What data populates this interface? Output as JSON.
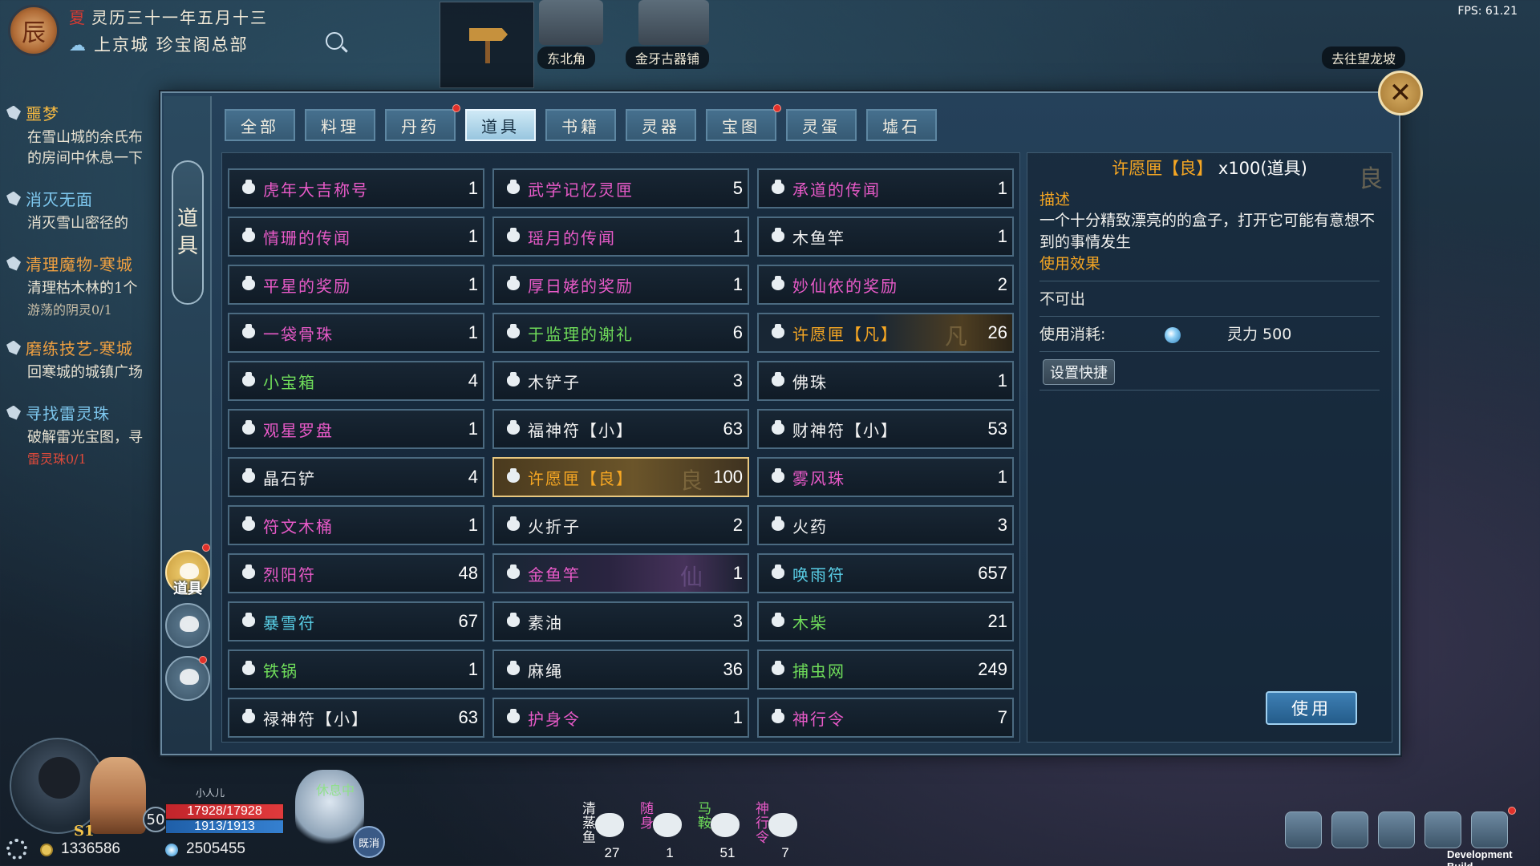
{
  "header": {
    "badge": "辰",
    "season": "夏",
    "date": "灵历三十一年五月十三",
    "location": "上京城  珍宝阁总部",
    "fps": "FPS: 61.21"
  },
  "map_labels": {
    "northeast": "东北角",
    "shop": "金牙古器铺",
    "goto": "去往望龙坡"
  },
  "quests": [
    {
      "title": "噩梦",
      "title_color": "#f5b942",
      "desc": "在雪山城的余氏布",
      "desc2": "的房间中休息一下",
      "progress": ""
    },
    {
      "title": "消灭无面",
      "title_color": "#7ec8ef",
      "desc": "消灭雪山密径的",
      "desc2": "",
      "progress": ""
    },
    {
      "title": "清理魔物-寒城",
      "title_color": "#f0a040",
      "desc": "清理枯木林的1个",
      "desc2": "",
      "progress": "游荡的阴灵0/1"
    },
    {
      "title": "磨练技艺-寒城",
      "title_color": "#f0a040",
      "desc": "回寒城的城镇广场",
      "desc2": "",
      "progress": ""
    },
    {
      "title": "寻找雷灵珠",
      "title_color": "#7ec8ef",
      "desc": "破解雷光宝图，寻",
      "desc2": "",
      "progress": "雷灵珠0/1"
    }
  ],
  "rail": {
    "tag": [
      "道",
      "具"
    ],
    "active_label": "道具"
  },
  "tabs": [
    {
      "label": "全部",
      "active": false,
      "dot": false
    },
    {
      "label": "料理",
      "active": false,
      "dot": false
    },
    {
      "label": "丹药",
      "active": false,
      "dot": true
    },
    {
      "label": "道具",
      "active": true,
      "dot": false
    },
    {
      "label": "书籍",
      "active": false,
      "dot": false
    },
    {
      "label": "灵器",
      "active": false,
      "dot": false
    },
    {
      "label": "宝图",
      "active": false,
      "dot": true
    },
    {
      "label": "灵蛋",
      "active": false,
      "dot": false
    },
    {
      "label": "墟石",
      "active": false,
      "dot": false
    }
  ],
  "colors": {
    "pink": "#e85ac8",
    "green": "#6fdc5a",
    "white": "#f2f2f2",
    "cyan": "#5ad0e8",
    "orange": "#f5a623"
  },
  "items": [
    {
      "name": "虎年大吉称号",
      "count": "1",
      "color": "pink"
    },
    {
      "name": "武学记忆灵匣",
      "count": "5",
      "color": "pink"
    },
    {
      "name": "承道的传闻",
      "count": "1",
      "color": "pink"
    },
    {
      "name": "情珊的传闻",
      "count": "1",
      "color": "pink"
    },
    {
      "name": "瑶月的传闻",
      "count": "1",
      "color": "pink"
    },
    {
      "name": "木鱼竿",
      "count": "1",
      "color": "white"
    },
    {
      "name": "平星的奖励",
      "count": "1",
      "color": "pink"
    },
    {
      "name": "厚日姥的奖励",
      "count": "1",
      "color": "pink"
    },
    {
      "name": "妙仙依的奖励",
      "count": "2",
      "color": "pink"
    },
    {
      "name": "一袋骨珠",
      "count": "1",
      "color": "pink"
    },
    {
      "name": "于监理的谢礼",
      "count": "6",
      "color": "green"
    },
    {
      "name": "许愿匣【凡】",
      "count": "26",
      "color": "orange",
      "style": "glow-gold",
      "mark": "凡"
    },
    {
      "name": "小宝箱",
      "count": "4",
      "color": "green"
    },
    {
      "name": "木铲子",
      "count": "3",
      "color": "white"
    },
    {
      "name": "佛珠",
      "count": "1",
      "color": "white"
    },
    {
      "name": "观星罗盘",
      "count": "1",
      "color": "pink"
    },
    {
      "name": "福神符【小】",
      "count": "63",
      "color": "white"
    },
    {
      "name": "财神符【小】",
      "count": "53",
      "color": "white"
    },
    {
      "name": "晶石铲",
      "count": "4",
      "color": "white"
    },
    {
      "name": "许愿匣【良】",
      "count": "100",
      "color": "orange",
      "style": "selected",
      "mark": "良"
    },
    {
      "name": "雾风珠",
      "count": "1",
      "color": "pink"
    },
    {
      "name": "符文木桶",
      "count": "1",
      "color": "pink"
    },
    {
      "name": "火折子",
      "count": "2",
      "color": "white"
    },
    {
      "name": "火药",
      "count": "3",
      "color": "white"
    },
    {
      "name": "烈阳符",
      "count": "48",
      "color": "pink"
    },
    {
      "name": "金鱼竿",
      "count": "1",
      "color": "pink",
      "style": "glow-purple",
      "mark": "仙"
    },
    {
      "name": "唤雨符",
      "count": "657",
      "color": "cyan"
    },
    {
      "name": "暴雪符",
      "count": "67",
      "color": "cyan"
    },
    {
      "name": "素油",
      "count": "3",
      "color": "white"
    },
    {
      "name": "木柴",
      "count": "21",
      "color": "green"
    },
    {
      "name": "铁锅",
      "count": "1",
      "color": "green"
    },
    {
      "name": "麻绳",
      "count": "36",
      "color": "white"
    },
    {
      "name": "捕虫网",
      "count": "249",
      "color": "green"
    },
    {
      "name": "禄神符【小】",
      "count": "63",
      "color": "white"
    },
    {
      "name": "护身令",
      "count": "1",
      "color": "pink"
    },
    {
      "name": "神行令",
      "count": "7",
      "color": "pink"
    }
  ],
  "detail": {
    "title_name": "许愿匣【良】",
    "title_suffix": "x100(道具)",
    "corner": "良",
    "desc_label": "描述",
    "desc": "一个十分精致漂亮的的盒子，打开它可能有意想不到的事情发生",
    "effect_label": "使用效果",
    "not_tradeable": "不可出",
    "cost_label": "使用消耗:",
    "cost_value": "灵力 500",
    "shortcut_label": "设置快捷",
    "use_label": "使用"
  },
  "hud": {
    "level": "50",
    "hp": "17928/17928",
    "mp": "1913/1913",
    "small_name": "小人儿",
    "s1": "S1",
    "coins": "1336586",
    "spirit": "2505455",
    "pet_status": "休息中",
    "pet_state": "既消",
    "quick": [
      {
        "label": "清蒸鱼",
        "count": "27",
        "color": "#f2f2f2"
      },
      {
        "label": "随身…",
        "count": "1",
        "color": "#e85ac8"
      },
      {
        "label": "马鞍…",
        "count": "51",
        "color": "#6fdc5a"
      },
      {
        "label": "神行令",
        "count": "7",
        "color": "#e85ac8"
      }
    ],
    "dev_build": "Development Build"
  }
}
